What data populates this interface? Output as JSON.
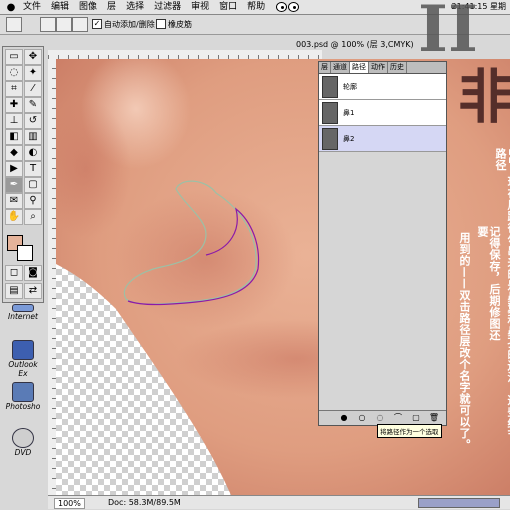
{
  "menubar": {
    "items": [
      "文件",
      "编辑",
      "图像",
      "层",
      "选择",
      "过滤器",
      "审视",
      "窗口",
      "帮助"
    ],
    "clock": "21:41:15 星期"
  },
  "options": {
    "auto_add_delete_label": "自动添加/删除",
    "auto_add_delete_checked": "✓",
    "rubber_band_label": "橡皮筋"
  },
  "document": {
    "title": "003.psd @ 100% (层 3,CMYK)",
    "zoom": "100%",
    "doc_size": "Doc: 58.3M/89.5M"
  },
  "big_title": {
    "part1": "II",
    "part2": "非"
  },
  "desktop_icons": [
    {
      "label": "Internet"
    },
    {
      "label": "Outlook Ex"
    },
    {
      "label": "Photosho"
    },
    {
      "label": "DVD"
    }
  ],
  "paths_palette": {
    "tabs": [
      "层",
      "通道",
      "路径",
      "动作",
      "历史"
    ],
    "rows": [
      {
        "name": "轮廓",
        "selected": false
      },
      {
        "name": "鼻1",
        "selected": false
      },
      {
        "name": "鼻2",
        "selected": true
      }
    ],
    "tooltip": "将路径作为一个选取"
  },
  "tutorial_text": {
    "col1": "11、现在用路径勾出来的是鼻翼和鼻孔的边沿，这些细节路径",
    "col2": "记得保存，后期修图还要",
    "col3": "用到的——双击路径层改个名字就可以了。"
  },
  "colors": {
    "foreground": "#e5b39a",
    "background": "#ffffff",
    "skin": "#e2a281",
    "path_stroke": "#8b1aa8"
  }
}
